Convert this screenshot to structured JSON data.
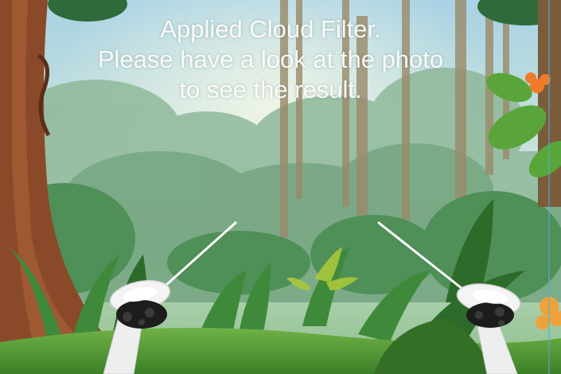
{
  "notification": {
    "lines": [
      "Applied Cloud Filter.",
      "Please have a look at the photo",
      "to see the result."
    ]
  },
  "scene": {
    "description_icon_names": [
      "vr-controller-left-icon",
      "vr-controller-right-icon",
      "laser-pointer-icon"
    ],
    "colors": {
      "sky": "#b8dbe6",
      "foliage_far": "#7fae8e",
      "foliage_mid": "#4f8f5a",
      "foliage_near": "#2f6e2e",
      "ground": "#5fa23a",
      "tree_trunk": "#8a4a2a",
      "flower": "#f07a2a",
      "controller": "#f2f2f2",
      "controller_dark": "#1c1c1c",
      "laser": "#ffffff"
    }
  }
}
